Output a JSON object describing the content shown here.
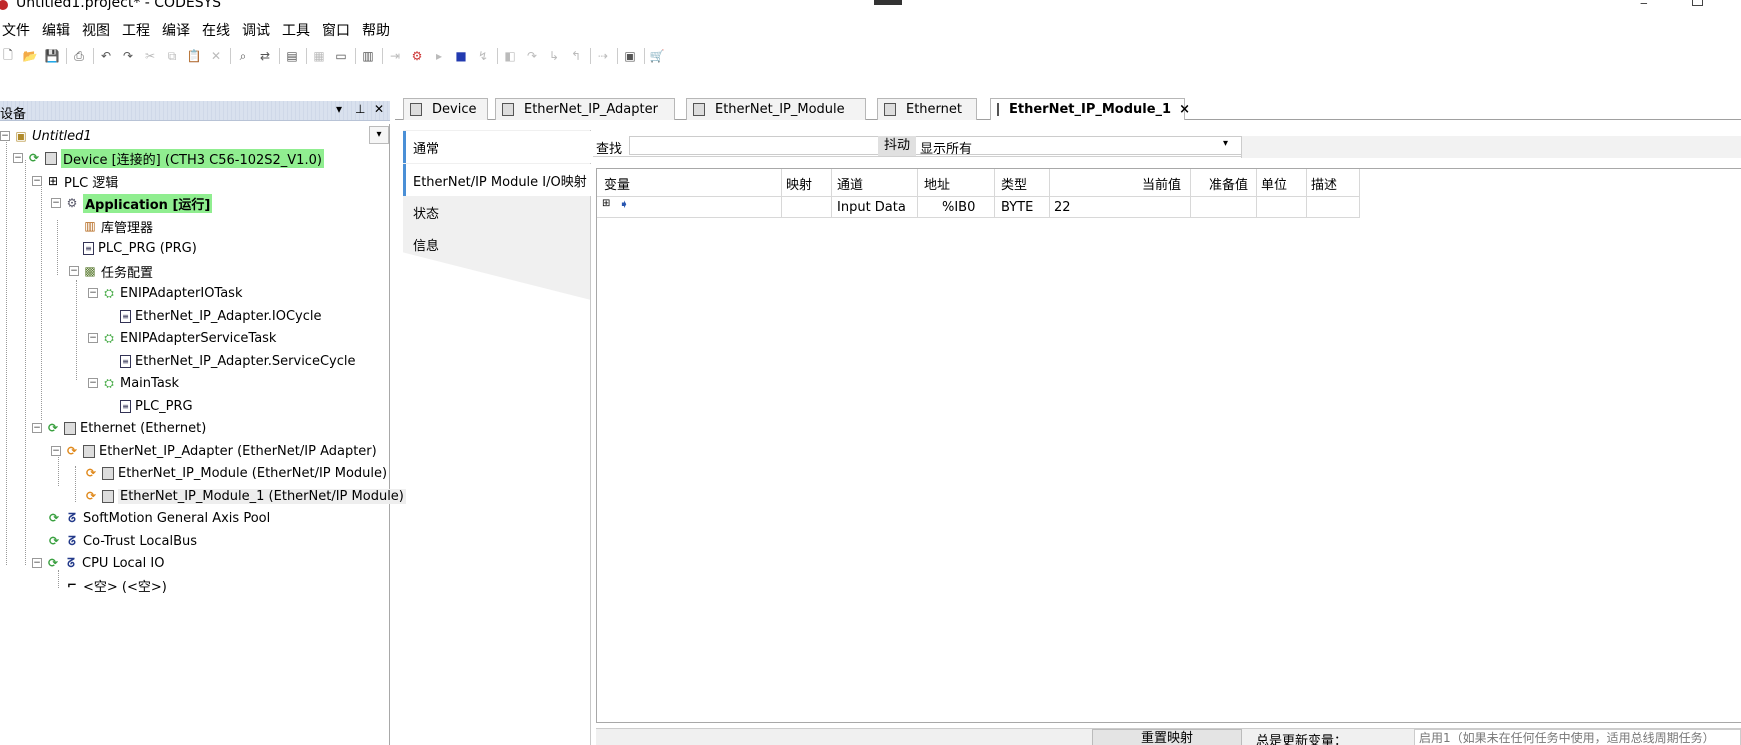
{
  "window": {
    "title": "Untitled1.project* - CODESYS",
    "minimize": "‒"
  },
  "menu": [
    "文件",
    "编辑",
    "视图",
    "工程",
    "编译",
    "在线",
    "调试",
    "工具",
    "窗口",
    "帮助"
  ],
  "toolbar": {
    "icons": [
      "new-icon",
      "open-icon",
      "save-icon",
      "print-icon",
      "undo-icon",
      "redo-icon",
      "cut-icon",
      "copy-icon",
      "paste-icon",
      "delete-icon",
      "find-icon",
      "replace-icon",
      "bookmark-icon",
      "add-object-icon",
      "insert-icon",
      "build-icon",
      "login-icon",
      "logout-icon",
      "run-icon",
      "stop-icon",
      "reset-icon",
      "breakpoint-icon",
      "step-over-icon",
      "step-into-icon",
      "step-out-icon",
      "run-to-cursor-icon",
      "force-icon",
      "write-icon",
      "cart-icon"
    ]
  },
  "devices_panel": {
    "title": "设备",
    "pin": "▾",
    "pin2": "⊥",
    "close": "✕",
    "tree": [
      {
        "label": "Untitled1",
        "style": "italic"
      },
      {
        "label": "Device [连接的] (CTH3 C56-102S2_V1.0)",
        "style": "highlight"
      },
      {
        "label": "PLC 逻辑"
      },
      {
        "label": "Application [运行]",
        "style": "highlight-bold"
      },
      {
        "label": "库管理器"
      },
      {
        "label": "PLC_PRG (PRG)"
      },
      {
        "label": "任务配置"
      },
      {
        "label": "ENIPAdapterIOTask"
      },
      {
        "label": "EtherNet_IP_Adapter.IOCycle"
      },
      {
        "label": "ENIPAdapterServiceTask"
      },
      {
        "label": "EtherNet_IP_Adapter.ServiceCycle"
      },
      {
        "label": "MainTask"
      },
      {
        "label": "PLC_PRG"
      },
      {
        "label": "Ethernet (Ethernet)"
      },
      {
        "label": "EtherNet_IP_Adapter (EtherNet/IP Adapter)"
      },
      {
        "label": "EtherNet_IP_Module (EtherNet/IP Module)"
      },
      {
        "label": "EtherNet_IP_Module_1 (EtherNet/IP Module)",
        "style": "selected"
      },
      {
        "label": "SoftMotion General Axis Pool"
      },
      {
        "label": "Co-Trust LocalBus"
      },
      {
        "label": "CPU Local IO"
      },
      {
        "label": "<空> (<空>)"
      }
    ]
  },
  "editor_tabs": [
    {
      "label": "Device"
    },
    {
      "label": "EtherNet_IP_Adapter"
    },
    {
      "label": "EtherNet_IP_Module"
    },
    {
      "label": "Ethernet"
    },
    {
      "label": "EtherNet_IP_Module_1",
      "active": true,
      "close": "×"
    }
  ],
  "side_nav": [
    "通常",
    "EtherNet/IP Module I/O映射",
    "状态",
    "信息"
  ],
  "findbar": {
    "label": "查找",
    "filter_label": "抖动",
    "filter_value": "显示所有",
    "arrow": "▾"
  },
  "grid": {
    "columns": [
      "变量",
      "映射",
      "通道",
      "地址",
      "类型",
      "当前值",
      "准备值",
      "单位",
      "描述"
    ],
    "rows": [
      {
        "expander": "⊞",
        "variable": "",
        "mapping": "",
        "channel": "Input Data",
        "address": "%IB0",
        "type": "BYTE",
        "current": "22",
        "prepared": "",
        "unit": "",
        "description": ""
      }
    ]
  },
  "bottombar": {
    "button": "重置映射",
    "label": "总是更新变量：",
    "select": "启用1（如果未在任何任务中使用，适用总线周期任务）"
  }
}
